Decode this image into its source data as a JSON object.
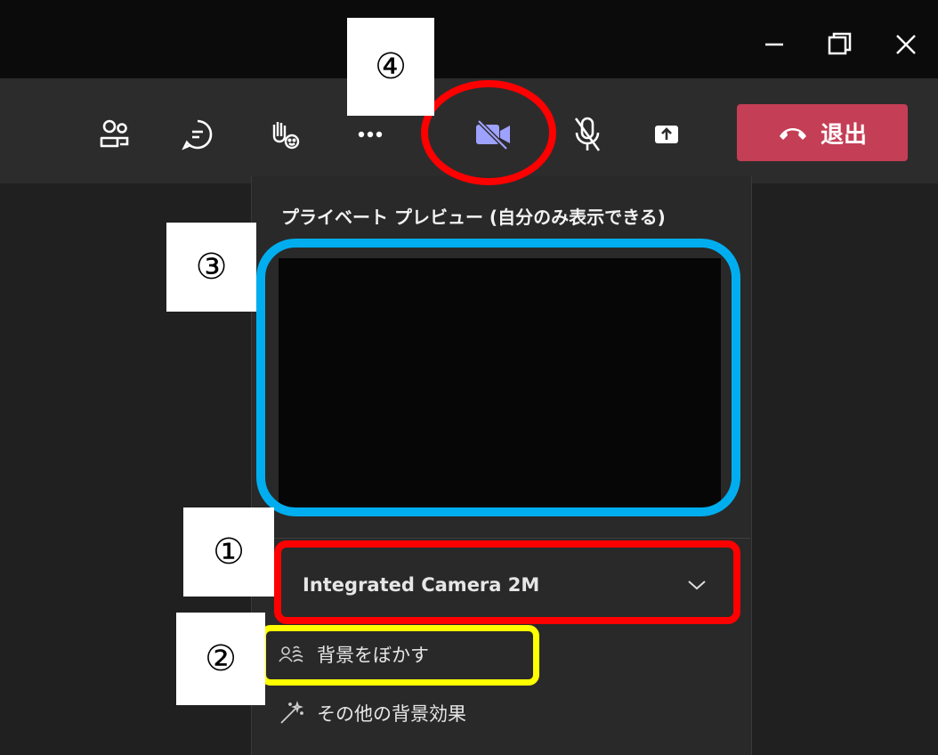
{
  "window": {
    "minimize_icon": "minimize-icon",
    "maximize_icon": "restore-icon",
    "close_icon": "close-icon"
  },
  "toolbar": {
    "icons": [
      "participants-icon",
      "chat-icon",
      "reactions-icon",
      "more-icon",
      "camera-off-icon",
      "mic-off-icon",
      "share-icon"
    ],
    "leave_label": "退出",
    "leave_color": "#c43e55"
  },
  "panel": {
    "title": "プライベート プレビュー (自分のみ表示できる)",
    "camera_select": "Integrated Camera 2M",
    "options": [
      {
        "icon": "blur-background-icon",
        "label": "背景をぼかす"
      },
      {
        "icon": "magic-wand-icon",
        "label": "その他の背景効果"
      }
    ]
  },
  "annotations": {
    "marker_1": "①",
    "marker_2": "②",
    "marker_3": "③",
    "marker_4": "④",
    "colors": {
      "red": "#ff0000",
      "blue": "#00aeef",
      "yellow": "#ffff00"
    }
  }
}
